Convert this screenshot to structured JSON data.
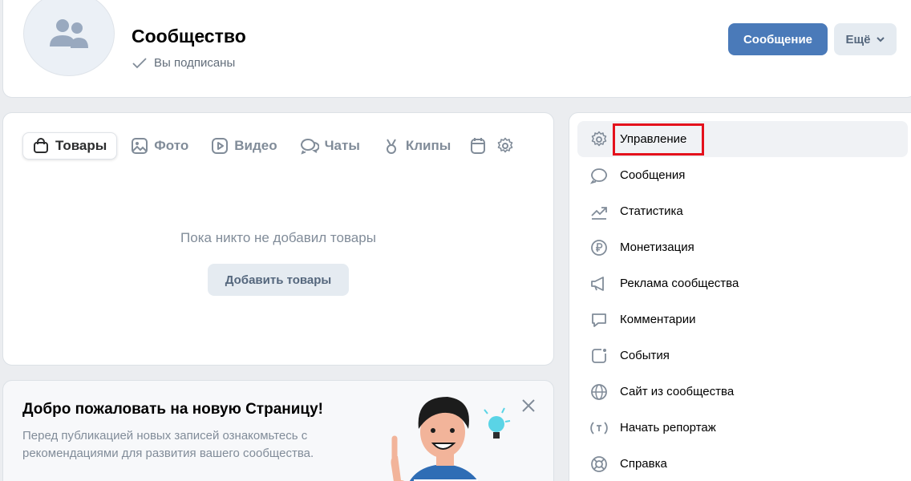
{
  "header": {
    "title": "Сообщество",
    "subscription_status": "Вы подписаны",
    "message_button": "Сообщение",
    "more_button": "Ещё"
  },
  "tabs": {
    "items": [
      {
        "label": "Товары",
        "icon": "bag-icon",
        "active": true
      },
      {
        "label": "Фото",
        "icon": "photo-icon"
      },
      {
        "label": "Видео",
        "icon": "video-icon"
      },
      {
        "label": "Чаты",
        "icon": "chats-icon"
      },
      {
        "label": "Клипы",
        "icon": "clips-icon"
      }
    ],
    "extra_icons": [
      "calendar-icon",
      "gear-icon"
    ],
    "empty_text": "Пока никто не добавил товары",
    "add_button": "Добавить товары"
  },
  "welcome": {
    "title": "Добро пожаловать на новую Страницу!",
    "text": "Перед публикацией новых записей ознакомьтесь с рекомендациями для развития вашего сообщества."
  },
  "side_menu": {
    "items": [
      {
        "label": "Управление",
        "icon": "gear-icon",
        "active": true,
        "highlighted": true
      },
      {
        "label": "Сообщения",
        "icon": "message-bubble-icon"
      },
      {
        "label": "Статистика",
        "icon": "trend-icon"
      },
      {
        "label": "Монетизация",
        "icon": "ruble-icon"
      },
      {
        "label": "Реклама сообщества",
        "icon": "megaphone-icon"
      },
      {
        "label": "Комментарии",
        "icon": "comment-icon"
      },
      {
        "label": "События",
        "icon": "event-icon"
      },
      {
        "label": "Сайт из сообщества",
        "icon": "globe-icon"
      },
      {
        "label": "Начать репортаж",
        "icon": "broadcast-icon"
      },
      {
        "label": "Справка",
        "icon": "help-lifebuoy-icon"
      }
    ]
  },
  "colors": {
    "accent": "#4a7ab9",
    "highlight": "#e4111c",
    "muted_text": "#818c99"
  }
}
